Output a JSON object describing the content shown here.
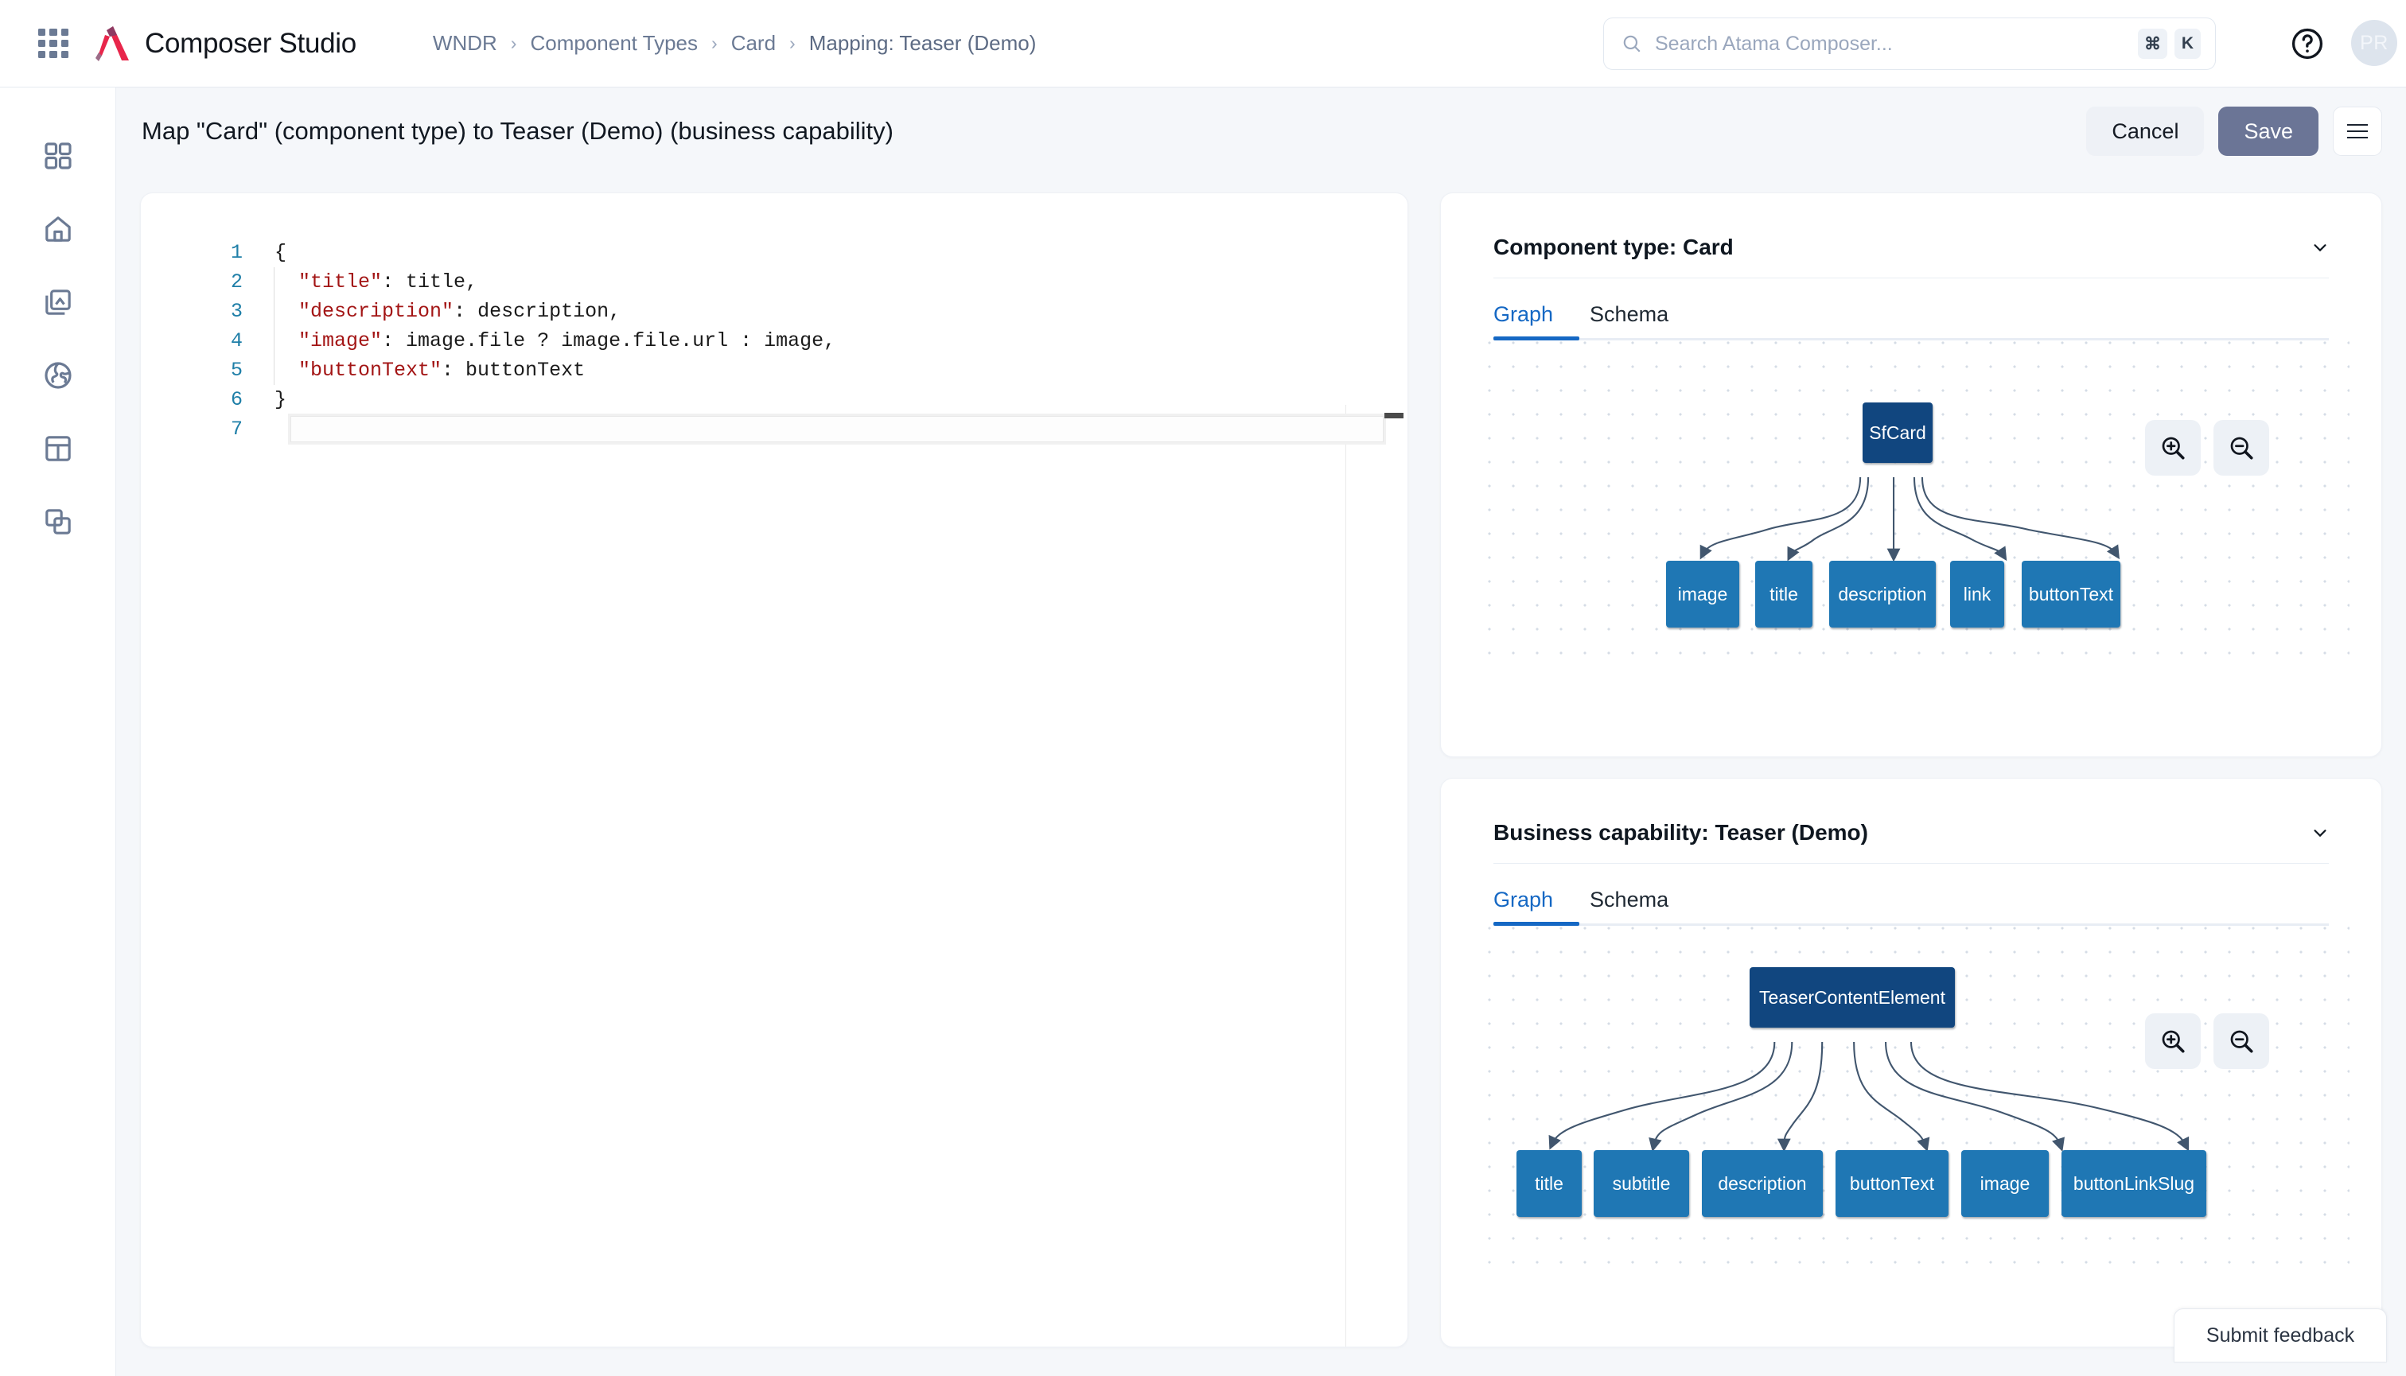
{
  "app": {
    "name": "Composer Studio",
    "logo_colors": {
      "primary": "#e8264b",
      "accent": "#8e3a62"
    }
  },
  "topbar": {
    "waffle_icon": "apps-grid-icon",
    "breadcrumb": [
      {
        "label": "WNDR"
      },
      {
        "label": "Component Types"
      },
      {
        "label": "Card"
      },
      {
        "label": "Mapping: Teaser (Demo)"
      }
    ],
    "breadcrumb_separator": "›",
    "search": {
      "placeholder": "Search Atama Composer...",
      "value": "",
      "icon": "search-icon",
      "shortcut_keys": [
        "⌘",
        "K"
      ]
    },
    "help_icon": "question-circle-icon",
    "avatar_initials": "PR"
  },
  "sidebar": {
    "items": [
      {
        "name": "dashboard",
        "icon": "grid-icon"
      },
      {
        "name": "home",
        "icon": "home-icon"
      },
      {
        "name": "media",
        "icon": "images-icon"
      },
      {
        "name": "sites",
        "icon": "globe-icon"
      },
      {
        "name": "layouts",
        "icon": "layout-icon"
      },
      {
        "name": "components",
        "icon": "copy-icon"
      }
    ]
  },
  "page": {
    "title": "Map \"Card\" (component type)  to Teaser (Demo) (business capability)",
    "cancel_label": "Cancel",
    "save_label": "Save",
    "menu_icon": "hamburger-icon"
  },
  "editor": {
    "lines": [
      {
        "n": "1",
        "segments": [
          {
            "t": "{",
            "c": "punct"
          }
        ]
      },
      {
        "n": "2",
        "segments": [
          {
            "t": "  ",
            "c": "punct"
          },
          {
            "t": "\"title\"",
            "c": "key"
          },
          {
            "t": ": title,",
            "c": "punct"
          }
        ]
      },
      {
        "n": "3",
        "segments": [
          {
            "t": "  ",
            "c": "punct"
          },
          {
            "t": "\"description\"",
            "c": "key"
          },
          {
            "t": ": description,",
            "c": "punct"
          }
        ]
      },
      {
        "n": "4",
        "segments": [
          {
            "t": "  ",
            "c": "punct"
          },
          {
            "t": "\"image\"",
            "c": "key"
          },
          {
            "t": ": image.file ? image.file.url : image,",
            "c": "punct"
          }
        ]
      },
      {
        "n": "5",
        "segments": [
          {
            "t": "  ",
            "c": "punct"
          },
          {
            "t": "\"buttonText\"",
            "c": "key"
          },
          {
            "t": ": buttonText",
            "c": "punct"
          }
        ]
      },
      {
        "n": "6",
        "segments": [
          {
            "t": "}",
            "c": "punct"
          }
        ]
      },
      {
        "n": "7",
        "segments": [
          {
            "t": "",
            "c": "punct"
          }
        ]
      }
    ],
    "active_line": 7,
    "colors": {
      "gutter": "#1f7fa8",
      "key": "#a31515",
      "text": "#1b1b1b"
    }
  },
  "panels": [
    {
      "id": "card",
      "title": "Component type: Card",
      "collapse_icon": "chevron-down-icon",
      "tabs": [
        {
          "label": "Graph",
          "active": true
        },
        {
          "label": "Schema",
          "active": false
        }
      ],
      "zoom_in_icon": "zoom-in-icon",
      "zoom_out_icon": "zoom-out-icon",
      "graph": {
        "root": {
          "label": "SfCard",
          "color": "#11467f"
        },
        "children": [
          {
            "label": "image"
          },
          {
            "label": "title"
          },
          {
            "label": "description"
          },
          {
            "label": "link"
          },
          {
            "label": "buttonText"
          }
        ],
        "child_color": "#1f77b4"
      }
    },
    {
      "id": "capability",
      "title": "Business capability: Teaser (Demo)",
      "collapse_icon": "chevron-down-icon",
      "tabs": [
        {
          "label": "Graph",
          "active": true
        },
        {
          "label": "Schema",
          "active": false
        }
      ],
      "zoom_in_icon": "zoom-in-icon",
      "zoom_out_icon": "zoom-out-icon",
      "graph": {
        "root": {
          "label": "TeaserContentElement",
          "color": "#11467f"
        },
        "children": [
          {
            "label": "title"
          },
          {
            "label": "subtitle"
          },
          {
            "label": "description"
          },
          {
            "label": "buttonText"
          },
          {
            "label": "image"
          },
          {
            "label": "buttonLinkSlug"
          }
        ],
        "child_color": "#1f77b4"
      }
    }
  ],
  "feedback": {
    "label": "Submit feedback"
  }
}
